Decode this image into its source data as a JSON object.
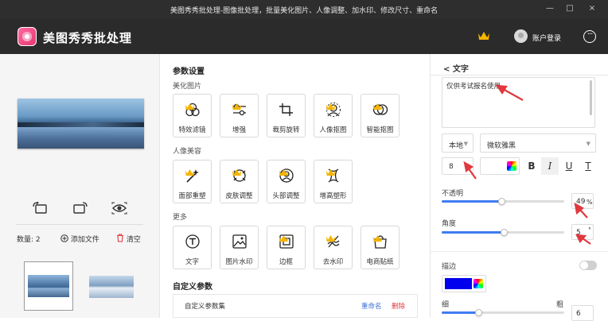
{
  "window": {
    "title": "美图秀秀批处理-图像批处理，批量美化图片、人像调整、加水印、修改尺寸、重命名",
    "min": "—",
    "max": "□",
    "close": "×"
  },
  "header": {
    "app_name": "美图秀秀批处理",
    "login": "账户登录",
    "more": "···"
  },
  "left": {
    "count_label": "数量:",
    "count": "2",
    "add_file": "添加文件",
    "clear": "清空"
  },
  "mid": {
    "section_title": "参数设置",
    "beautify": {
      "label": "美化图片",
      "tools": [
        "特效滤镜",
        "增强",
        "裁剪旋转",
        "人像抠图",
        "智能抠图"
      ]
    },
    "portrait": {
      "label": "人像美容",
      "tools": [
        "面部重塑",
        "皮肤调整",
        "头部调整",
        "增高塑形"
      ]
    },
    "more": {
      "label": "更多",
      "tools": [
        "文字",
        "图片水印",
        "边框",
        "去水印",
        "电商贴纸"
      ]
    },
    "custom": {
      "title": "自定义参数",
      "row": "自定义参数集",
      "rename": "重命名",
      "delete": "删除"
    }
  },
  "right": {
    "back": "< 文字",
    "text_value": "仅供考试报名使用",
    "location": "本地",
    "font": "微软雅黑",
    "size": "8",
    "format_buttons": [
      "B",
      "I",
      "U",
      "T"
    ],
    "opacity_label": "不透明",
    "opacity_value": "49",
    "opacity_unit": "%",
    "opacity": 0.49,
    "angle_label": "角度",
    "angle_value": "5",
    "angle_unit": "°",
    "angle": 0.51,
    "stroke_label": "描边",
    "stroke_color": "#0000ee",
    "thin": "细",
    "thick": "粗",
    "stroke_value": "6",
    "stroke_width": 0.3
  },
  "colors": {
    "accent": "#3f7cf2",
    "crown": "#f5b400",
    "annotation": "#e0383e"
  }
}
